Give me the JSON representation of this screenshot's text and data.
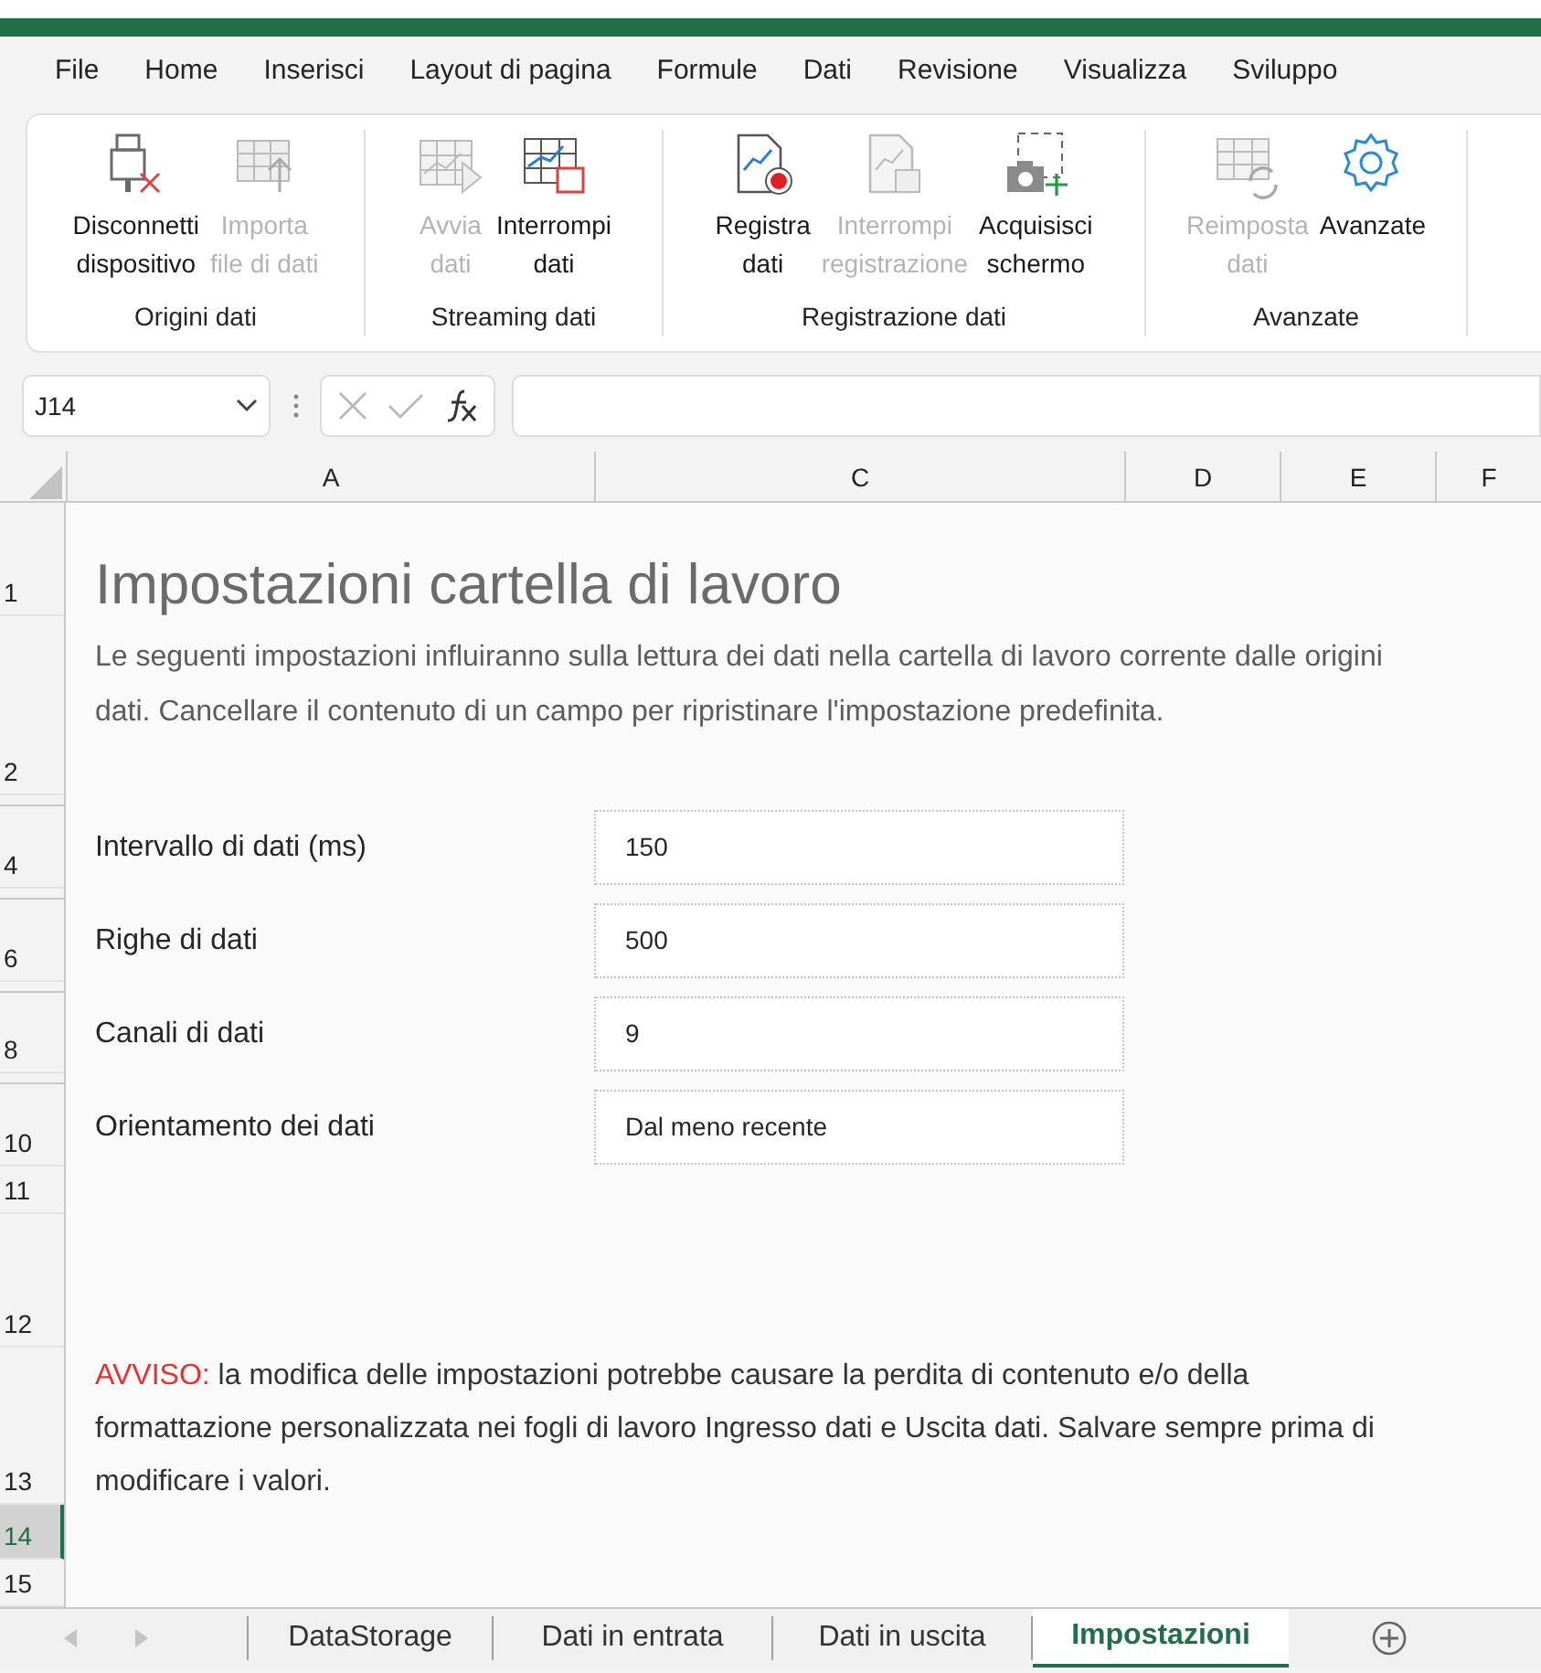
{
  "menu": [
    {
      "label": "File"
    },
    {
      "label": "Home"
    },
    {
      "label": "Inserisci"
    },
    {
      "label": "Layout di pagina"
    },
    {
      "label": "Formule"
    },
    {
      "label": "Dati"
    },
    {
      "label": "Revisione"
    },
    {
      "label": "Visualizza"
    },
    {
      "label": "Sviluppo"
    }
  ],
  "ribbon": [
    {
      "label": "Origini dati",
      "buttons": [
        {
          "label": "Disconnetti\ndispositivo",
          "disabled": false
        },
        {
          "label": "Importa\nfile di dati",
          "disabled": true
        }
      ]
    },
    {
      "label": "Streaming dati",
      "buttons": [
        {
          "label": "Avvia\ndati",
          "disabled": true
        },
        {
          "label": "Interrompi\ndati",
          "disabled": false
        }
      ]
    },
    {
      "label": "Registrazione dati",
      "buttons": [
        {
          "label": "Registra\ndati",
          "disabled": false
        },
        {
          "label": "Interrompi\nregistrazione",
          "disabled": true
        },
        {
          "label": "Acquisisci\nschermo",
          "disabled": false
        }
      ]
    },
    {
      "label": "Avanzate",
      "buttons": [
        {
          "label": "Reimposta\ndati",
          "disabled": true
        },
        {
          "label": "Avanzate",
          "disabled": false
        }
      ]
    }
  ],
  "name_box": "J14",
  "columns": [
    "A",
    "C",
    "D",
    "E",
    "F"
  ],
  "rows": [
    {
      "number": "1",
      "selected": false
    },
    {
      "number": "2",
      "selected": false
    },
    {
      "number": "4",
      "selected": false
    },
    {
      "number": "6",
      "selected": false
    },
    {
      "number": "8",
      "selected": false
    },
    {
      "number": "10",
      "selected": false
    },
    {
      "number": "11",
      "selected": false
    },
    {
      "number": "12",
      "selected": false
    },
    {
      "number": "13",
      "selected": false
    },
    {
      "number": "14",
      "selected": true
    },
    {
      "number": "15",
      "selected": false
    }
  ],
  "title": "Impostazioni cartella di lavoro",
  "description": "Le seguenti impostazioni influiranno sulla lettura dei dati nella cartella di lavoro corrente dalle origini dati. Cancellare il contenuto di un campo per ripristinare l'impostazione predefinita.",
  "settings": [
    {
      "label": "Intervallo di dati (ms)",
      "value": "150"
    },
    {
      "label": "Righe di dati",
      "value": "500"
    },
    {
      "label": "Canali di dati",
      "value": "9"
    },
    {
      "label": "Orientamento dei dati",
      "value": "Dal meno recente"
    }
  ],
  "warning": {
    "lead": "AVVISO:",
    "text": " la modifica delle impostazioni potrebbe causare la perdita di contenuto e/o della formattazione personalizzata nei fogli di lavoro Ingresso dati e Uscita dati. Salvare sempre prima di modificare i valori."
  },
  "sheets": [
    {
      "label": "DataStorage",
      "selected": false
    },
    {
      "label": "Dati in entrata",
      "selected": false
    },
    {
      "label": "Dati in uscita",
      "selected": false
    },
    {
      "label": "Impostazioni",
      "selected": true
    }
  ]
}
